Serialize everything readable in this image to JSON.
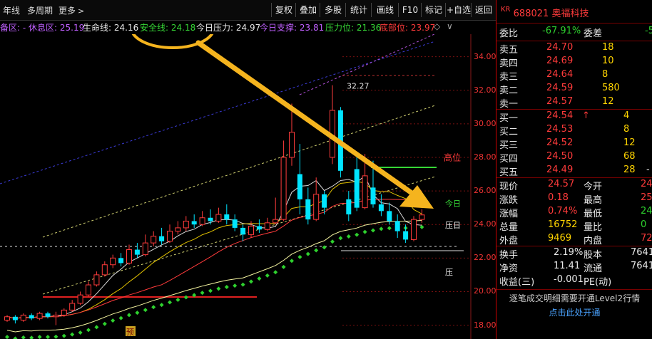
{
  "toolbar": {
    "year_label": "年线",
    "multi_period_label": "多周期",
    "more_label": "更多",
    "more_icon": "chevron-right",
    "buttons": [
      "复权",
      "叠加",
      "多股",
      "统计",
      "画线",
      "F10",
      "标记",
      "+自选",
      "返回"
    ]
  },
  "indicators": {
    "zone_label": "备区: -",
    "rest_label": "休息区: 25.19",
    "life_label": "生命线: 24.16",
    "safe_label": "安全线: 24.18",
    "today_pressure_label": "今日压力: 24.97",
    "today_support_label": "今日支撑: 23.81",
    "pressure_label": "压力位: 21.36",
    "bottom_label": "底部位: 23.97"
  },
  "chart_data": {
    "type": "candlestick",
    "y_axis_ticks": [
      "34.00",
      "32.00",
      "30.00",
      "28.00",
      "26.00",
      "24.00",
      "22.00",
      "20.00",
      "18.00"
    ],
    "ylim": [
      17.6,
      35.0
    ],
    "annotations": [
      "32.27",
      "高位",
      "今日",
      "压日",
      "压"
    ],
    "bottom_marker": "预",
    "candles": [
      {
        "o": 18.3,
        "c": 18.5,
        "h": 18.6,
        "l": 18.2
      },
      {
        "o": 18.5,
        "c": 18.3,
        "h": 18.6,
        "l": 18.1
      },
      {
        "o": 18.3,
        "c": 18.6,
        "h": 18.7,
        "l": 18.2
      },
      {
        "o": 18.6,
        "c": 18.4,
        "h": 18.7,
        "l": 18.3
      },
      {
        "o": 18.4,
        "c": 18.7,
        "h": 18.8,
        "l": 18.3
      },
      {
        "o": 18.7,
        "c": 18.5,
        "h": 18.8,
        "l": 18.4
      },
      {
        "o": 18.5,
        "c": 18.6,
        "h": 18.8,
        "l": 18.0
      },
      {
        "o": 18.6,
        "c": 18.9,
        "h": 19.0,
        "l": 18.5
      },
      {
        "o": 18.9,
        "c": 19.3,
        "h": 19.5,
        "l": 18.8
      },
      {
        "o": 19.3,
        "c": 19.8,
        "h": 20.0,
        "l": 19.2
      },
      {
        "o": 19.8,
        "c": 20.4,
        "h": 20.6,
        "l": 19.7
      },
      {
        "o": 20.4,
        "c": 21.0,
        "h": 21.2,
        "l": 20.3
      },
      {
        "o": 21.0,
        "c": 21.6,
        "h": 21.8,
        "l": 20.9
      },
      {
        "o": 21.6,
        "c": 22.0,
        "h": 22.2,
        "l": 21.4
      },
      {
        "o": 22.0,
        "c": 21.7,
        "h": 22.3,
        "l": 21.5
      },
      {
        "o": 21.7,
        "c": 22.5,
        "h": 22.8,
        "l": 21.6
      },
      {
        "o": 22.5,
        "c": 22.2,
        "h": 22.9,
        "l": 22.0
      },
      {
        "o": 22.2,
        "c": 22.9,
        "h": 23.4,
        "l": 22.1
      },
      {
        "o": 22.9,
        "c": 23.3,
        "h": 23.6,
        "l": 22.7
      },
      {
        "o": 23.3,
        "c": 23.0,
        "h": 23.8,
        "l": 22.8
      },
      {
        "o": 23.0,
        "c": 23.6,
        "h": 24.0,
        "l": 22.9
      },
      {
        "o": 23.6,
        "c": 23.8,
        "h": 24.2,
        "l": 23.4
      },
      {
        "o": 23.8,
        "c": 24.2,
        "h": 24.5,
        "l": 23.6
      },
      {
        "o": 24.2,
        "c": 24.0,
        "h": 24.6,
        "l": 23.8
      },
      {
        "o": 24.0,
        "c": 24.4,
        "h": 24.8,
        "l": 23.9
      },
      {
        "o": 24.4,
        "c": 24.2,
        "h": 24.9,
        "l": 24.0
      },
      {
        "o": 24.2,
        "c": 24.6,
        "h": 25.0,
        "l": 24.1
      },
      {
        "o": 24.6,
        "c": 24.3,
        "h": 25.2,
        "l": 24.0
      },
      {
        "o": 24.3,
        "c": 23.8,
        "h": 24.6,
        "l": 23.6
      },
      {
        "o": 23.8,
        "c": 23.4,
        "h": 24.0,
        "l": 23.0
      },
      {
        "o": 23.4,
        "c": 23.9,
        "h": 24.2,
        "l": 23.2
      },
      {
        "o": 23.9,
        "c": 23.7,
        "h": 24.3,
        "l": 23.5
      },
      {
        "o": 23.7,
        "c": 24.1,
        "h": 24.4,
        "l": 23.6
      },
      {
        "o": 24.1,
        "c": 24.3,
        "h": 25.6,
        "l": 24.0
      },
      {
        "o": 24.3,
        "c": 28.0,
        "h": 29.0,
        "l": 24.2
      },
      {
        "o": 28.0,
        "c": 29.5,
        "h": 31.2,
        "l": 27.5
      },
      {
        "o": 27.0,
        "c": 25.5,
        "h": 28.8,
        "l": 24.6
      },
      {
        "o": 25.5,
        "c": 24.3,
        "h": 26.2,
        "l": 24.0
      },
      {
        "o": 24.3,
        "c": 25.8,
        "h": 26.8,
        "l": 24.2
      },
      {
        "o": 25.8,
        "c": 25.0,
        "h": 26.0,
        "l": 24.6
      },
      {
        "o": 28.0,
        "c": 30.8,
        "h": 32.3,
        "l": 27.6
      },
      {
        "o": 30.8,
        "c": 27.2,
        "h": 31.0,
        "l": 26.8
      },
      {
        "o": 25.5,
        "c": 24.6,
        "h": 26.0,
        "l": 24.2
      },
      {
        "o": 27.3,
        "c": 25.0,
        "h": 28.0,
        "l": 24.8
      },
      {
        "o": 25.0,
        "c": 26.9,
        "h": 28.2,
        "l": 24.9
      },
      {
        "o": 26.2,
        "c": 25.2,
        "h": 27.8,
        "l": 25.0
      },
      {
        "o": 25.2,
        "c": 24.8,
        "h": 25.8,
        "l": 24.5
      },
      {
        "o": 24.8,
        "c": 24.2,
        "h": 25.3,
        "l": 24.0
      },
      {
        "o": 24.2,
        "c": 23.6,
        "h": 24.6,
        "l": 23.2
      },
      {
        "o": 23.6,
        "c": 23.1,
        "h": 24.0,
        "l": 22.9
      },
      {
        "o": 23.1,
        "c": 24.3,
        "h": 24.5,
        "l": 23.0
      },
      {
        "o": 24.3,
        "c": 24.57,
        "h": 24.9,
        "l": 24.1
      }
    ]
  },
  "quote": {
    "code": "688021",
    "name": "奥福科技",
    "kr_badge": "KR",
    "wei_bi_label": "委比",
    "wei_bi_value": "-67.91%",
    "wei_cha_label": "委差",
    "wei_cha_value": "-5",
    "asks": [
      {
        "label": "卖五",
        "price": "24.70",
        "vol": "18"
      },
      {
        "label": "卖四",
        "price": "24.69",
        "vol": "10"
      },
      {
        "label": "卖三",
        "price": "24.64",
        "vol": "8"
      },
      {
        "label": "卖二",
        "price": "24.59",
        "vol": "580"
      },
      {
        "label": "卖一",
        "price": "24.57",
        "vol": "12"
      }
    ],
    "bids": [
      {
        "label": "买一",
        "price": "24.54",
        "vol": "4",
        "arrow": "↑"
      },
      {
        "label": "买二",
        "price": "24.53",
        "vol": "8"
      },
      {
        "label": "买三",
        "price": "24.52",
        "vol": "12"
      },
      {
        "label": "买四",
        "price": "24.50",
        "vol": "68"
      },
      {
        "label": "买五",
        "price": "24.49",
        "vol": "28",
        "tail": "-"
      }
    ],
    "stats": [
      {
        "l1": "现价",
        "v1": "24.57",
        "l2": "今开",
        "v2": "24"
      },
      {
        "l1": "涨跌",
        "v1": "0.18",
        "l2": "最高",
        "v2": "25"
      },
      {
        "l1": "涨幅",
        "v1": "0.74%",
        "l2": "最低",
        "v2": "24"
      },
      {
        "l1": "总量",
        "v1": "16752",
        "l2": "量比",
        "v2": "0"
      },
      {
        "l1": "外盘",
        "v1": "9469",
        "l2": "内盘",
        "v2": "72"
      }
    ],
    "stats2": [
      {
        "l1": "换手",
        "v1": "2.19%",
        "l2": "股本",
        "v2": "7641"
      },
      {
        "l1": "净资",
        "v1": "11.41",
        "l2": "流通",
        "v2": "7641"
      },
      {
        "l1": "收益(三)",
        "v1": "-0.001",
        "l2": "PE(动)",
        "v2": ""
      }
    ],
    "notice_line1": "逐笔成交明细需要开通Level2行情",
    "notice_link": "点击此处开通"
  }
}
